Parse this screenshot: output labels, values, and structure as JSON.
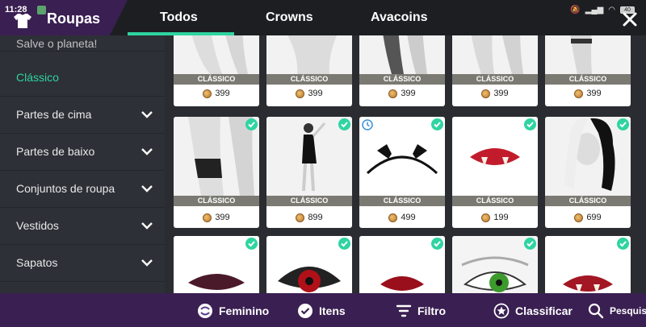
{
  "status": {
    "time": "11:28",
    "battery": "40"
  },
  "header": {
    "title": "Roupas",
    "tabs": [
      {
        "label": "Todos",
        "active": true
      },
      {
        "label": "Crowns",
        "active": false
      },
      {
        "label": "Avacoins",
        "active": false
      }
    ],
    "accent": "#2fd4a1"
  },
  "sidebar": {
    "items": [
      {
        "label": "Salve o planeta!"
      },
      {
        "label": "Clássico"
      },
      {
        "label": "Partes de cima"
      },
      {
        "label": "Partes de baixo"
      },
      {
        "label": "Conjuntos de roupa"
      },
      {
        "label": "Vestidos"
      },
      {
        "label": "Sapatos"
      }
    ]
  },
  "grid": {
    "rows": [
      [
        {
          "tag": "CLÁSSICO",
          "price": "399",
          "icon": "legs-tattoo-icon"
        },
        {
          "tag": "CLÁSSICO",
          "price": "399",
          "icon": "torso-icon"
        },
        {
          "tag": "CLÁSSICO",
          "price": "399",
          "icon": "lace-tights-icon"
        },
        {
          "tag": "CLÁSSICO",
          "price": "399",
          "icon": "legs-icon"
        },
        {
          "tag": "CLÁSSICO",
          "price": "399",
          "icon": "garter-icon"
        }
      ],
      [
        {
          "tag": "CLÁSSICO",
          "price": "399",
          "icon": "lace-garter-icon"
        },
        {
          "tag": "CLÁSSICO",
          "price": "899",
          "icon": "black-dress-icon"
        },
        {
          "tag": "CLÁSSICO",
          "price": "499",
          "icon": "bat-headband-icon"
        },
        {
          "tag": "CLÁSSICO",
          "price": "199",
          "icon": "fangs-lips-icon"
        },
        {
          "tag": "CLÁSSICO",
          "price": "699",
          "icon": "hair-icon"
        }
      ],
      [
        {
          "icon": "dark-lips-icon"
        },
        {
          "icon": "red-eye-icon"
        },
        {
          "icon": "red-lips-icon"
        },
        {
          "icon": "green-eye-icon"
        },
        {
          "icon": "vampire-lips-icon"
        }
      ]
    ]
  },
  "bottombar": {
    "items": [
      {
        "label": "Feminino",
        "icon": "gender-swap-icon"
      },
      {
        "label": "Itens",
        "icon": "check-circle-icon"
      },
      {
        "label": "Filtro",
        "icon": "filter-icon"
      },
      {
        "label": "Classificar",
        "icon": "star-circle-icon"
      },
      {
        "label": "Pesquisa",
        "icon": "search-icon"
      }
    ]
  }
}
